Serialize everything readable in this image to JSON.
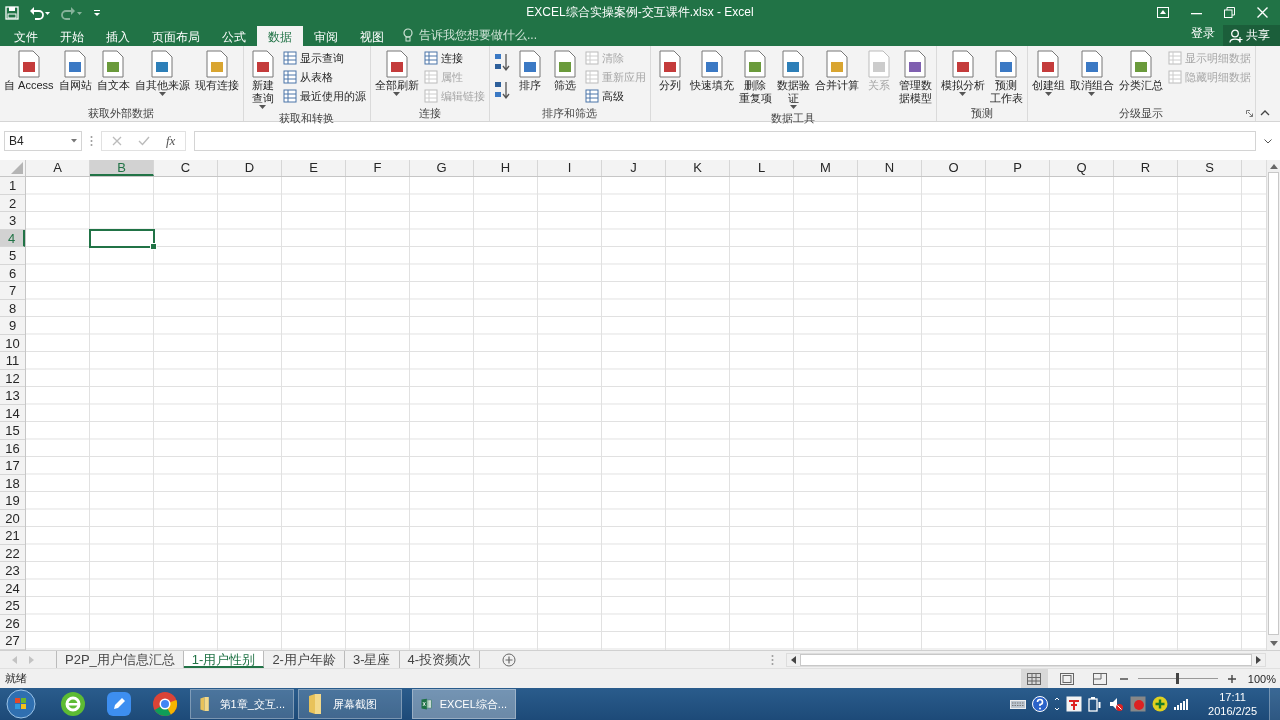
{
  "window": {
    "title": "EXCEL综合实操案例-交互课件.xlsx - Excel",
    "sign_in": "登录",
    "share": "共享"
  },
  "quick_access": [
    {
      "kind": "save",
      "disabled": false
    },
    {
      "kind": "undo",
      "disabled": false
    },
    {
      "kind": "redo",
      "disabled": true
    },
    {
      "kind": "customize",
      "disabled": false
    }
  ],
  "tabs": [
    {
      "label": "文件",
      "selected": false
    },
    {
      "label": "开始",
      "selected": false
    },
    {
      "label": "插入",
      "selected": false
    },
    {
      "label": "页面布局",
      "selected": false
    },
    {
      "label": "公式",
      "selected": false
    },
    {
      "label": "数据",
      "selected": true
    },
    {
      "label": "审阅",
      "selected": false
    },
    {
      "label": "视图",
      "selected": false
    }
  ],
  "tell_me": {
    "placeholder": "告诉我您想要做什么..."
  },
  "ribbon_groups": [
    {
      "label": "获取外部数据",
      "launcher": false,
      "items": [
        {
          "kind": "large",
          "label": "自 Access",
          "dropdown": false,
          "disabled": false
        },
        {
          "kind": "large",
          "label": "自网站",
          "dropdown": false,
          "disabled": false
        },
        {
          "kind": "large",
          "label": "自文本",
          "dropdown": false,
          "disabled": false
        },
        {
          "kind": "large",
          "label": "自其他来源",
          "dropdown": true,
          "disabled": false
        },
        {
          "kind": "large",
          "label": "现有连接",
          "dropdown": false,
          "disabled": false
        }
      ]
    },
    {
      "label": "获取和转换",
      "launcher": false,
      "items": [
        {
          "kind": "large",
          "lines": [
            "新建",
            "查询"
          ],
          "dropdown": true,
          "disabled": false
        },
        {
          "kind": "stack",
          "items": [
            {
              "label": "显示查询",
              "disabled": false
            },
            {
              "label": "从表格",
              "disabled": false
            },
            {
              "label": "最近使用的源",
              "disabled": false
            }
          ]
        }
      ]
    },
    {
      "label": "连接",
      "launcher": false,
      "items": [
        {
          "kind": "large",
          "label": "全部刷新",
          "dropdown": true,
          "disabled": false
        },
        {
          "kind": "stack",
          "items": [
            {
              "label": "连接",
              "disabled": false
            },
            {
              "label": "属性",
              "disabled": true
            },
            {
              "label": "编辑链接",
              "disabled": true
            }
          ]
        }
      ]
    },
    {
      "label": "排序和筛选",
      "launcher": false,
      "items": [
        {
          "kind": "sort"
        },
        {
          "kind": "large",
          "label": "排序",
          "dropdown": false,
          "disabled": false
        },
        {
          "kind": "large",
          "label": "筛选",
          "dropdown": false,
          "disabled": false
        },
        {
          "kind": "stack",
          "items": [
            {
              "label": "清除",
              "disabled": true
            },
            {
              "label": "重新应用",
              "disabled": true
            },
            {
              "label": "高级",
              "disabled": false
            }
          ]
        }
      ]
    },
    {
      "label": "数据工具",
      "launcher": false,
      "items": [
        {
          "kind": "large",
          "label": "分列",
          "dropdown": false,
          "disabled": false
        },
        {
          "kind": "large",
          "label": "快速填充",
          "dropdown": false,
          "disabled": false
        },
        {
          "kind": "large",
          "lines": [
            "删除",
            "重复项"
          ],
          "dropdown": false,
          "disabled": false
        },
        {
          "kind": "large",
          "lines": [
            "数据验",
            "证"
          ],
          "dropdown": true,
          "disabled": false
        },
        {
          "kind": "large",
          "label": "合并计算",
          "dropdown": false,
          "disabled": false
        },
        {
          "kind": "large",
          "label": "关系",
          "dropdown": false,
          "disabled": true
        },
        {
          "kind": "large",
          "lines": [
            "管理数",
            "据模型"
          ],
          "dropdown": false,
          "disabled": false
        }
      ]
    },
    {
      "label": "预测",
      "launcher": false,
      "items": [
        {
          "kind": "large",
          "label": "模拟分析",
          "dropdown": true,
          "disabled": false
        },
        {
          "kind": "large",
          "lines": [
            "预测",
            "工作表"
          ],
          "dropdown": false,
          "disabled": false
        }
      ]
    },
    {
      "label": "分级显示",
      "launcher": true,
      "items": [
        {
          "kind": "large",
          "label": "创建组",
          "dropdown": true,
          "disabled": false
        },
        {
          "kind": "large",
          "label": "取消组合",
          "dropdown": true,
          "disabled": false
        },
        {
          "kind": "large",
          "label": "分类汇总",
          "dropdown": false,
          "disabled": false
        },
        {
          "kind": "stack",
          "items": [
            {
              "label": "显示明细数据",
              "disabled": true
            },
            {
              "label": "隐藏明细数据",
              "disabled": true
            }
          ]
        }
      ]
    }
  ],
  "formula_bar": {
    "name_box": "B4",
    "function_label": "fx"
  },
  "columns": [
    {
      "label": "A",
      "selected": false
    },
    {
      "label": "B",
      "selected": true
    },
    {
      "label": "C",
      "selected": false
    },
    {
      "label": "D",
      "selected": false
    },
    {
      "label": "E",
      "selected": false
    },
    {
      "label": "F",
      "selected": false
    },
    {
      "label": "G",
      "selected": false
    },
    {
      "label": "H",
      "selected": false
    },
    {
      "label": "I",
      "selected": false
    },
    {
      "label": "J",
      "selected": false
    },
    {
      "label": "K",
      "selected": false
    },
    {
      "label": "L",
      "selected": false
    },
    {
      "label": "M",
      "selected": false
    },
    {
      "label": "N",
      "selected": false
    },
    {
      "label": "O",
      "selected": false
    },
    {
      "label": "P",
      "selected": false
    },
    {
      "label": "Q",
      "selected": false
    },
    {
      "label": "R",
      "selected": false
    },
    {
      "label": "S",
      "selected": false
    }
  ],
  "rows": [
    {
      "label": "1",
      "selected": false
    },
    {
      "label": "2",
      "selected": false
    },
    {
      "label": "3",
      "selected": false
    },
    {
      "label": "4",
      "selected": true
    },
    {
      "label": "5",
      "selected": false
    },
    {
      "label": "6",
      "selected": false
    },
    {
      "label": "7",
      "selected": false
    },
    {
      "label": "8",
      "selected": false
    },
    {
      "label": "9",
      "selected": false
    },
    {
      "label": "10",
      "selected": false
    },
    {
      "label": "11",
      "selected": false
    },
    {
      "label": "12",
      "selected": false
    },
    {
      "label": "13",
      "selected": false
    },
    {
      "label": "14",
      "selected": false
    },
    {
      "label": "15",
      "selected": false
    },
    {
      "label": "16",
      "selected": false
    },
    {
      "label": "17",
      "selected": false
    },
    {
      "label": "18",
      "selected": false
    },
    {
      "label": "19",
      "selected": false
    },
    {
      "label": "20",
      "selected": false
    },
    {
      "label": "21",
      "selected": false
    },
    {
      "label": "22",
      "selected": false
    },
    {
      "label": "23",
      "selected": false
    },
    {
      "label": "24",
      "selected": false
    },
    {
      "label": "25",
      "selected": false
    },
    {
      "label": "26",
      "selected": false
    },
    {
      "label": "27",
      "selected": false
    }
  ],
  "sheet_tabs": [
    {
      "label": "P2P_用户信息汇总",
      "selected": false
    },
    {
      "label": "1-用户性别",
      "selected": true
    },
    {
      "label": "2-用户年龄",
      "selected": false
    },
    {
      "label": "3-星座",
      "selected": false
    },
    {
      "label": "4-投资频次",
      "selected": false
    }
  ],
  "status_bar": {
    "status": "就绪",
    "views": [
      {
        "kind": "normal",
        "selected": true
      },
      {
        "kind": "layout",
        "selected": false
      },
      {
        "kind": "pagebreak",
        "selected": false
      }
    ],
    "zoom": {
      "level": 0.5,
      "reading": "100%"
    }
  },
  "taskbar": {
    "pinned": [
      {
        "kind": "ie"
      },
      {
        "kind": "pencil"
      },
      {
        "kind": "chrome"
      }
    ],
    "tasks": [
      {
        "kind": "folder",
        "label": "第1章_交互...",
        "selected": false
      },
      {
        "kind": "folder",
        "label": "屏幕截图",
        "selected": false
      },
      {
        "kind": "excel",
        "label": "EXCEL综合...",
        "selected": true
      }
    ],
    "time": "17:11",
    "date": "2016/2/25"
  }
}
